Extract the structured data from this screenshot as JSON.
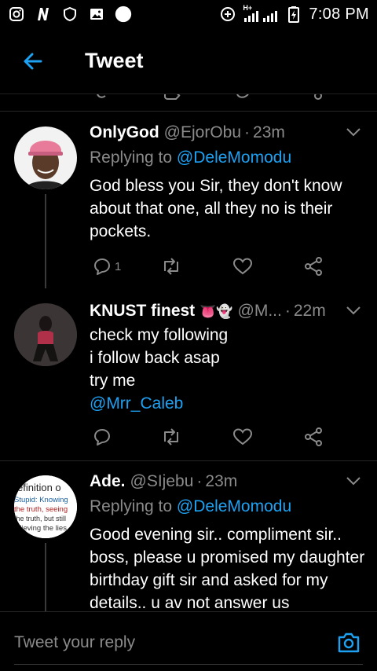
{
  "status_bar": {
    "time": "7:08 PM",
    "left_icons": [
      "instagram-icon",
      "netflix-icon",
      "shield-icon",
      "gallery-icon",
      "notification-dot-icon"
    ],
    "right_icons": [
      "data-saver-icon",
      "signal-icon",
      "battery-icon"
    ],
    "network_label": "H+"
  },
  "header": {
    "title": "Tweet",
    "back_icon": "arrow-left-icon"
  },
  "colors": {
    "accent": "#1da1f2",
    "muted": "#8a8a8a",
    "background": "#000000"
  },
  "tweets": [
    {
      "name": "OnlyGod",
      "handle": "@EjorObu",
      "time": "23m",
      "replying_prefix": "Replying to",
      "replying_to": "@DeleMomodu",
      "lines": [
        "God bless you Sir,  they don't know about that one, all they no is their pockets."
      ],
      "reply_count": "1",
      "emojis": ""
    },
    {
      "name": "KNUST finest",
      "emojis": "👅👻",
      "handle": "@M...",
      "time": "22m",
      "lines": [
        "check my following",
        "i follow back asap",
        "try me"
      ],
      "mention": "@Mrr_Caleb",
      "reply_count": ""
    },
    {
      "name": "Ade.",
      "handle": "@SIjebu",
      "time": "23m",
      "replying_prefix": "Replying to",
      "replying_to": "@DeleMomodu",
      "lines": [
        "Good evening sir.. compliment sir.. boss, please u promised my daughter birthday gift sir and asked for my details.. u av not answer us"
      ],
      "avatar_text": [
        "efinition o",
        "Stupid: Knowing",
        "the truth, seeing",
        "the truth, but still",
        "elieving the lies"
      ]
    }
  ],
  "reply_bar": {
    "placeholder": "Tweet your reply",
    "camera_icon": "camera-icon"
  }
}
